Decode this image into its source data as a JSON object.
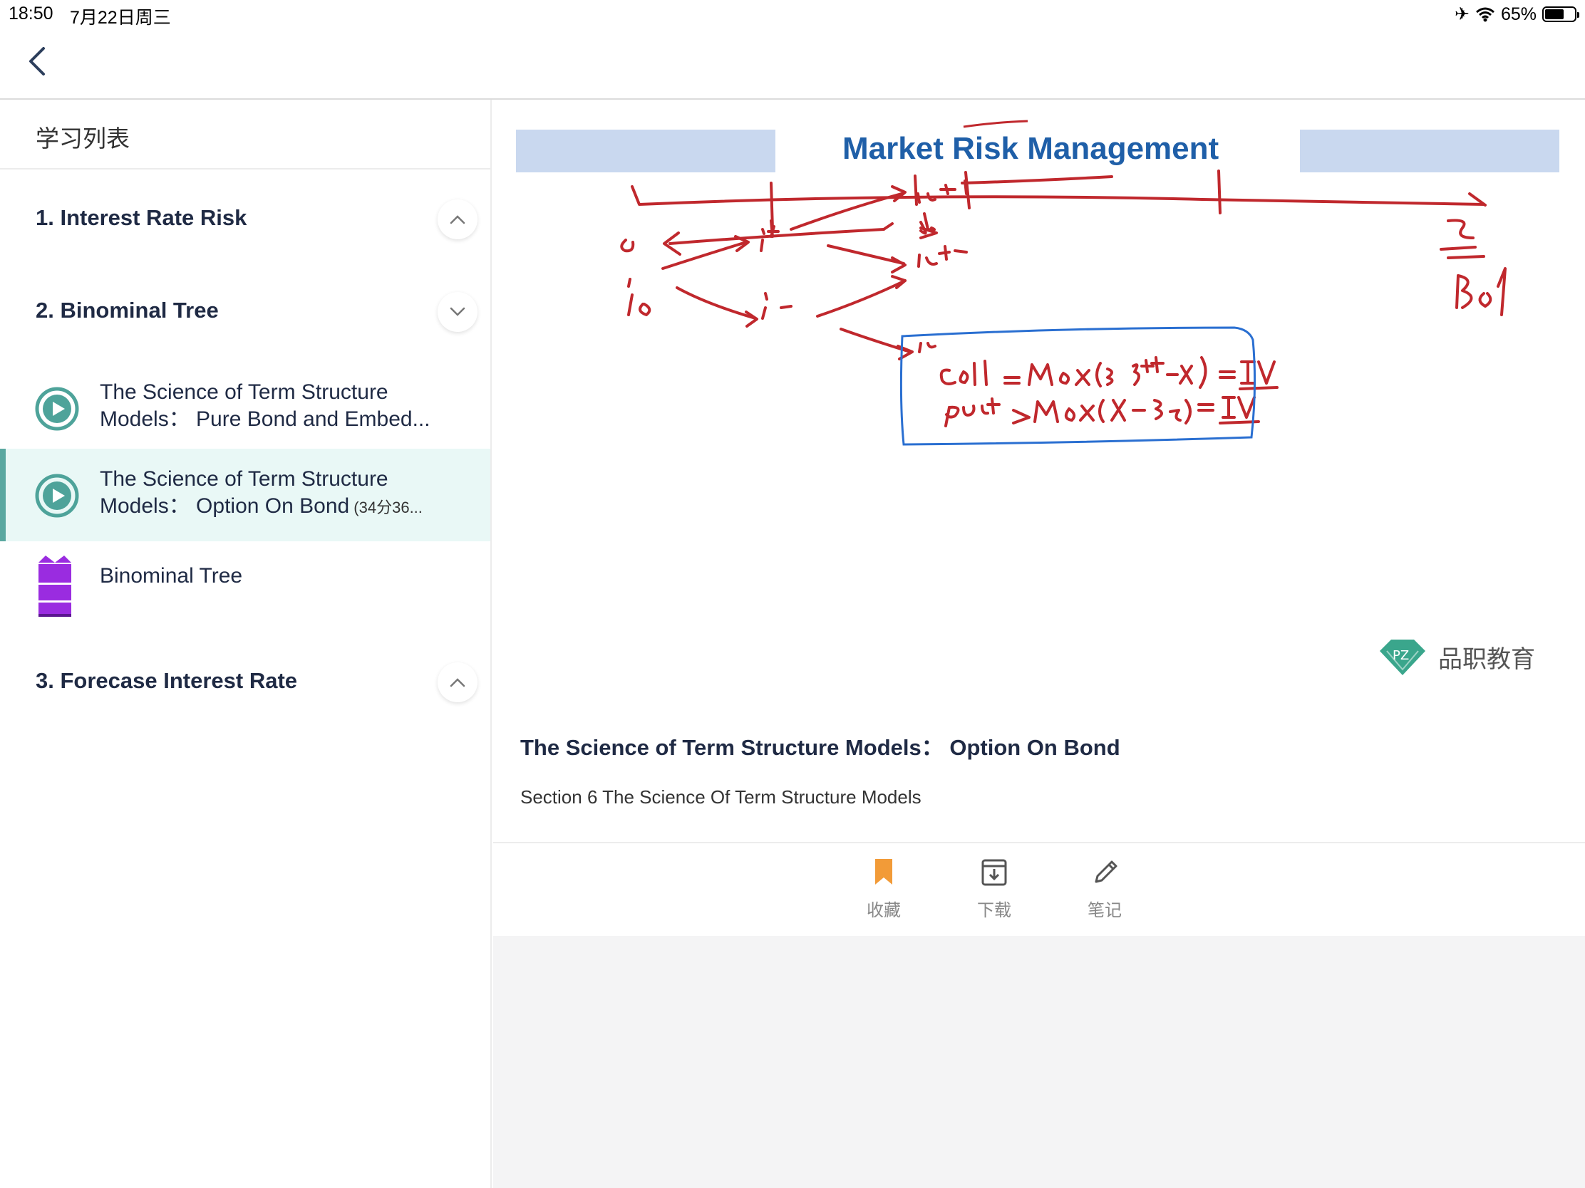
{
  "status_bar": {
    "time": "18:50",
    "date": "7月22日周三",
    "battery": "65%",
    "battery_level": 0.65
  },
  "sidebar": {
    "title": "学习列表",
    "chapters": [
      {
        "label": "1. Interest Rate Risk",
        "state": "collapsed"
      },
      {
        "label": "2. Binominal Tree",
        "state": "expanded"
      },
      {
        "label": "3. Forecase Interest Rate",
        "state": "collapsed"
      }
    ],
    "lessons": [
      {
        "line1": "The Science of Term Structure",
        "line2": "Models：  Pure Bond and Embed...",
        "duration": ""
      },
      {
        "line1": "The Science of Term Structure",
        "line2": "Models：  Option On Bond",
        "duration": " (34分36..."
      },
      {
        "line1": "Binominal Tree",
        "line2": "",
        "duration": ""
      }
    ]
  },
  "video": {
    "slide_title": "Market Risk Management",
    "watermark": "品职教育"
  },
  "info": {
    "title": "The Science of Term Structure Models：  Option On Bond",
    "section": "Section 6 The Science Of Term Structure Models"
  },
  "actions": {
    "favorite": "收藏",
    "download": "下载",
    "notes": "笔记"
  },
  "colors": {
    "accent": "#5aa8a0",
    "active_bg": "#e9f8f6",
    "favorite": "#f29b38",
    "annotation_red": "#c0282d",
    "annotation_blue": "#2a6fd1",
    "doc_icon": "#9a2ce0"
  }
}
